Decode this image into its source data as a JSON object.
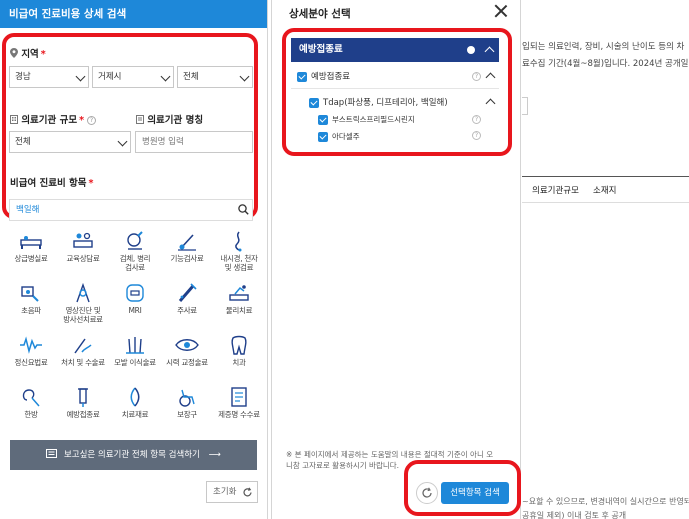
{
  "left": {
    "header": "비급여 진료비용 상세 검색",
    "region": {
      "label": "지역",
      "required": "*",
      "province": "경남",
      "city": "거제시",
      "district": "전체"
    },
    "scale": {
      "label": "의료기관 규모",
      "required": "*",
      "help": "?",
      "value": "전체"
    },
    "name": {
      "label": "의료기관 명칭",
      "placeholder": "병원명 입력"
    },
    "item": {
      "label": "비급여 진료비 항목",
      "required": "*",
      "value": "백일해"
    },
    "categories": [
      {
        "label": "상급병실료",
        "icon": "bed-icon"
      },
      {
        "label": "교육상담료",
        "icon": "consult-icon"
      },
      {
        "label": "검체, 병리\n검사료",
        "icon": "microscope-icon"
      },
      {
        "label": "기능검사료",
        "icon": "test-icon"
      },
      {
        "label": "내시경, 천자\n및 생검료",
        "icon": "endoscope-icon"
      },
      {
        "label": "초음파",
        "icon": "ultrasound-icon"
      },
      {
        "label": "영상진단 및\n방사선치료료",
        "icon": "radiology-icon"
      },
      {
        "label": "MRI",
        "icon": "mri-icon"
      },
      {
        "label": "주사료",
        "icon": "syringe-icon"
      },
      {
        "label": "물리치료",
        "icon": "physio-icon"
      },
      {
        "label": "정신요법료",
        "icon": "brainwave-icon"
      },
      {
        "label": "처치 및 수술료",
        "icon": "surgery-icon"
      },
      {
        "label": "모발 이식술료",
        "icon": "hair-icon"
      },
      {
        "label": "시력 교정술료",
        "icon": "eye-icon"
      },
      {
        "label": "치과",
        "icon": "tooth-icon"
      },
      {
        "label": "한방",
        "icon": "acupuncture-icon"
      },
      {
        "label": "예방접종료",
        "icon": "vaccine-icon"
      },
      {
        "label": "치료재료",
        "icon": "material-icon"
      },
      {
        "label": "보장구",
        "icon": "wheelchair-icon"
      },
      {
        "label": "제증명 수수료",
        "icon": "certificate-icon"
      }
    ],
    "search_all": "보고싶은 의료기관 전체 항목 검색하기",
    "reset": "초기화"
  },
  "modal": {
    "title": "상세분야 선택",
    "head": "예방접종료",
    "node1": "예방접종료",
    "node2": "Tdap(파상풍, 디프테리아, 백일해)",
    "node3": "부스트릭스프리필드시린지",
    "node4": "아다셀주",
    "help": "?",
    "notice": "※ 본 페이지에서 제공하는 도움말의 내용은 절대적 기준이 아니 오니참 고자료로 활용하시기 바랍니다.",
    "search_button": "선택항목 검색"
  },
  "background": {
    "line1": "입되는 의료인력, 장비, 시술의 난이도 등의 차",
    "line2": "료수집 기간(4월~8월)입니다. 2024년 공개일(8",
    "th1": "의료기관규모",
    "th2": "소재지",
    "bottom1": "~요할 수 있으므로, 변경내역이 실시간으로 반영되지",
    "bottom2": "공휴일 제외) 이내 검토 후 공개"
  },
  "colors": {
    "brand_blue": "#1e88d9",
    "navy": "#1f3f8a",
    "highlight_red": "#e8161d",
    "button_gray": "#5f6b7b"
  }
}
